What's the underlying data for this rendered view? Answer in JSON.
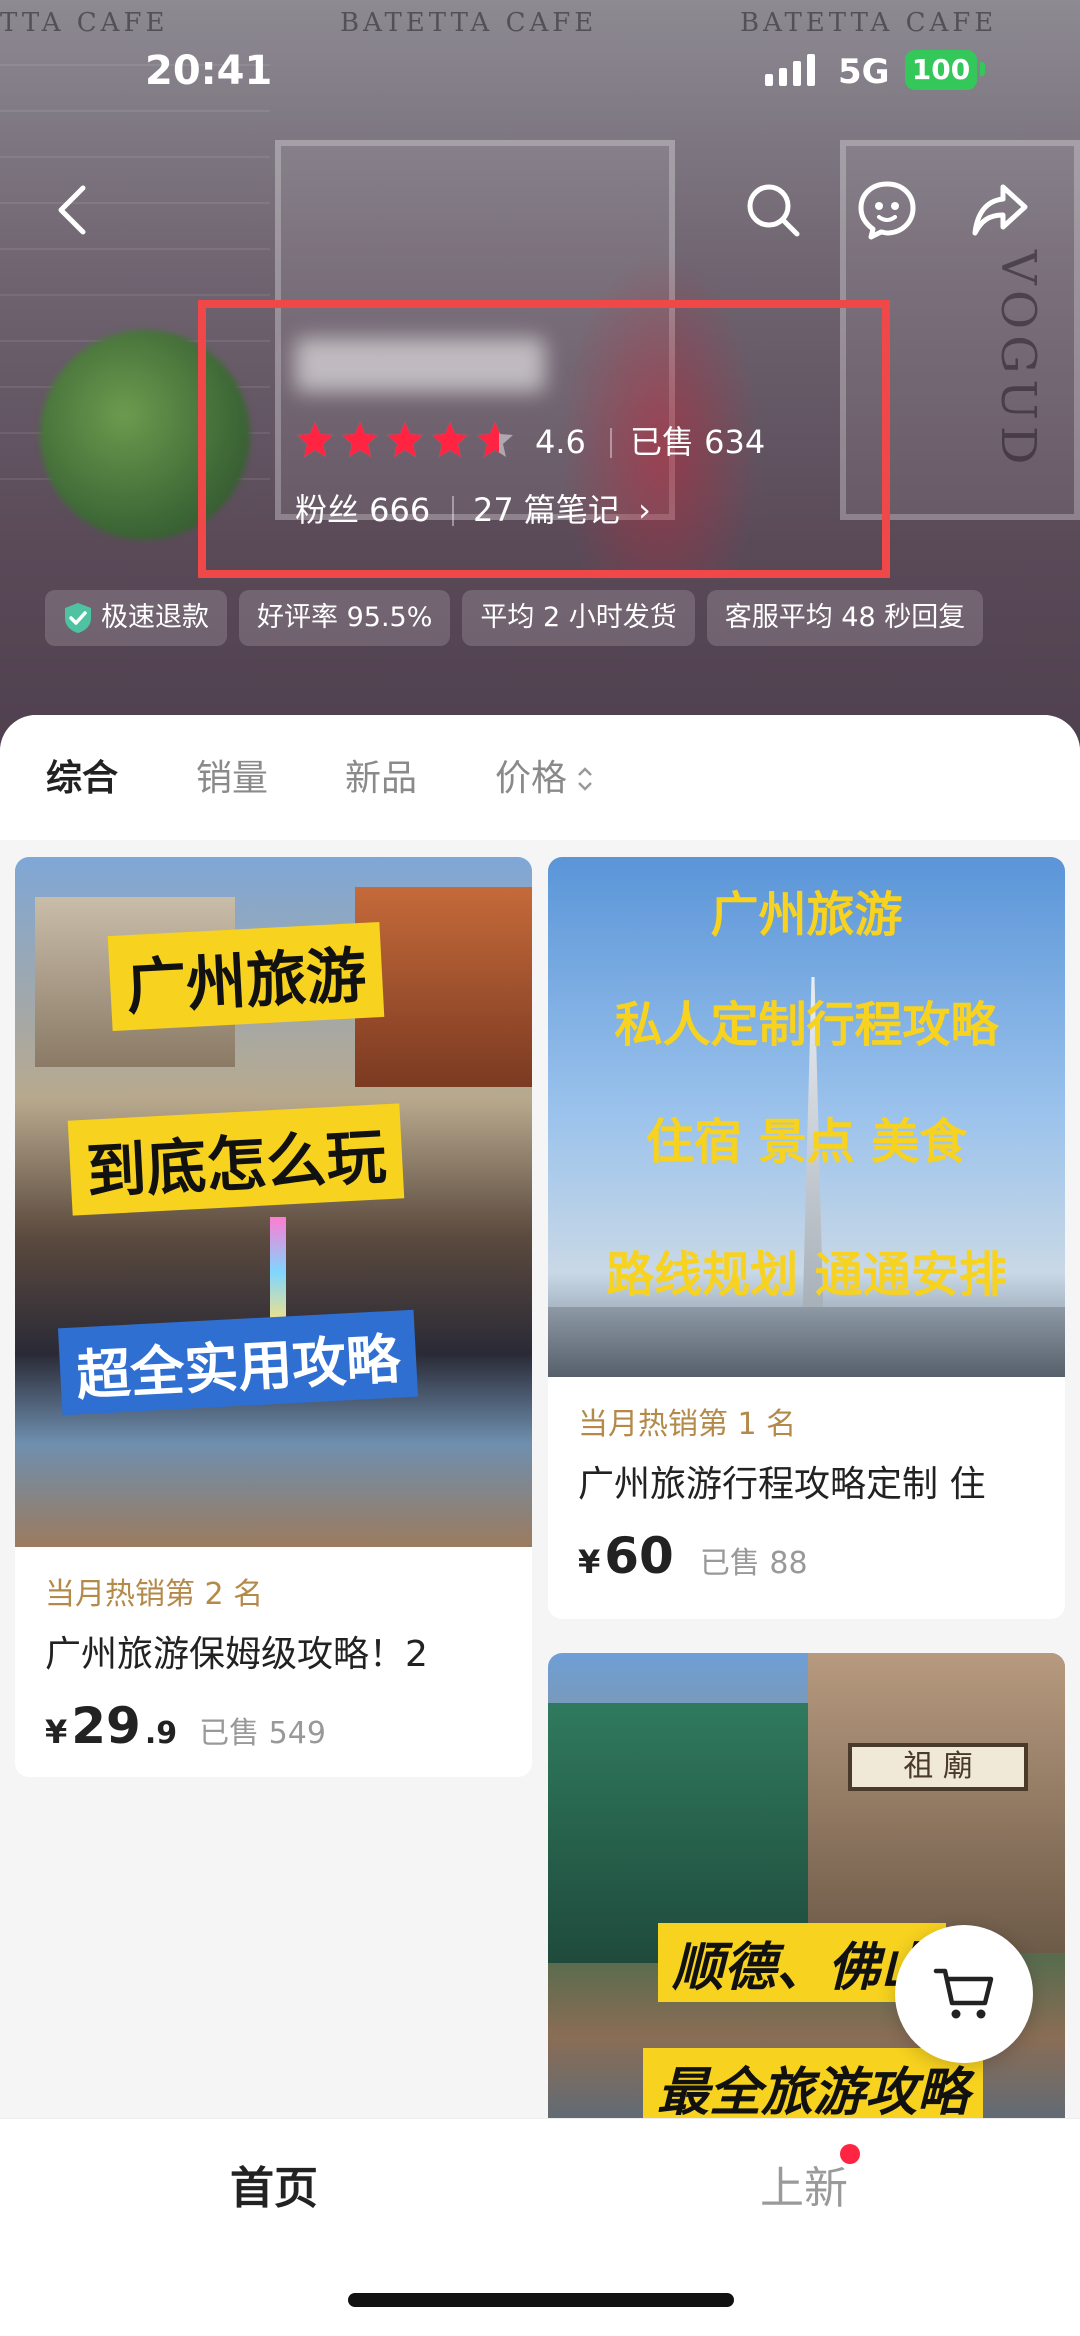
{
  "status_bar": {
    "time": "20:41",
    "network": "5G",
    "battery": "100"
  },
  "background": {
    "signs": [
      "TTA CAFE",
      "BATETTA CAFE",
      "BATETTA CAFE"
    ],
    "side_text": "VOGUD"
  },
  "shop": {
    "rating": "4.6",
    "sold": "已售 634",
    "fans": "粉丝 666",
    "notes": "27 篇笔记",
    "notes_chevron": "›",
    "stars_full": 4,
    "stars_partial": 0.6,
    "tags": [
      "极速退款",
      "好评率 95.5%",
      "平均 2 小时发货",
      "客服平均 48 秒回复"
    ]
  },
  "sort_tabs": [
    {
      "label": "综合",
      "active": true
    },
    {
      "label": "销量",
      "active": false
    },
    {
      "label": "新品",
      "active": false
    },
    {
      "label": "价格",
      "active": false
    }
  ],
  "products": [
    {
      "thumb_lines": [
        "广州旅游",
        "到底怎么玩",
        "超全实用攻略"
      ],
      "rank": "当月热销第 2 名",
      "title": "广州旅游保姆级攻略！2",
      "price_symbol": "¥",
      "price_int": "29",
      "price_dec": ".9",
      "sold": "已售 549"
    },
    {
      "thumb_lines": [
        "广州旅游",
        "私人定制行程攻略",
        "住宿 景点 美食",
        "路线规划 通通安排"
      ],
      "rank": "当月热销第 1 名",
      "title": "广州旅游行程攻略定制 住",
      "price_symbol": "¥",
      "price_int": "60",
      "price_dec": "",
      "sold": "已售 88"
    },
    {
      "thumb_lines": [
        "顺德、佛山",
        "最全旅游攻略"
      ],
      "sign_text": "祖 廟"
    }
  ],
  "bottom_nav": [
    {
      "label": "首页",
      "active": true
    },
    {
      "label": "上新",
      "active": false,
      "badge": true
    }
  ],
  "colors": {
    "highlight_box": "#f04848",
    "star": "#ff2442",
    "accent_rank": "#b48a4a",
    "yellow_text": "#f7d21f"
  },
  "icons": [
    "back-icon",
    "search-icon",
    "chat-icon",
    "share-icon",
    "shield-check-icon",
    "cart-icon"
  ]
}
